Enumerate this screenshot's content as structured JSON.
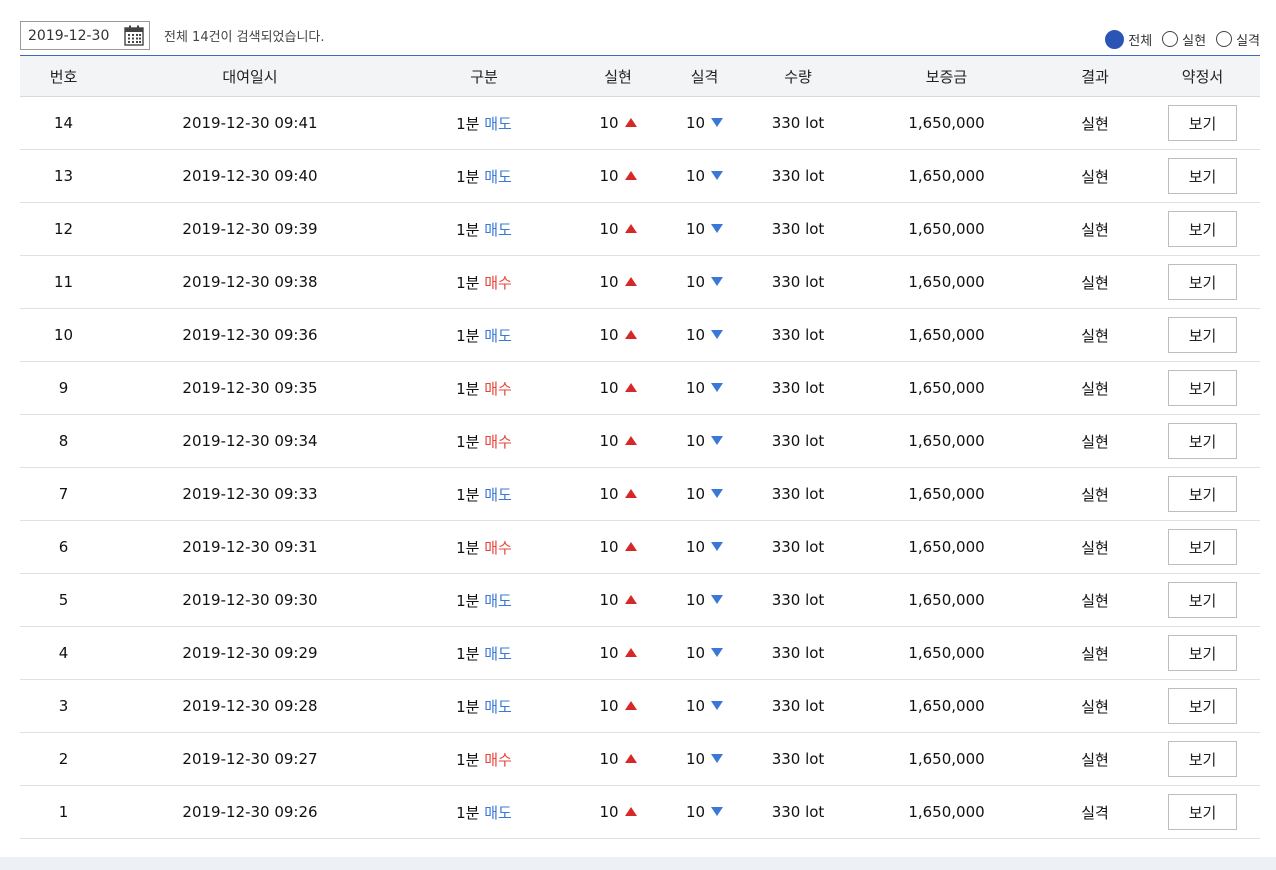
{
  "filter": {
    "date": "2019-12-30",
    "summary": "전체 14건이 검색되었습니다.",
    "radio_options": [
      {
        "label": "전체",
        "checked": true
      },
      {
        "label": "실현",
        "checked": false
      },
      {
        "label": "실격",
        "checked": false
      }
    ]
  },
  "table": {
    "columns": [
      "번호",
      "대여일시",
      "구분",
      "실현",
      "실격",
      "수량",
      "보증금",
      "결과",
      "약정서"
    ],
    "rows": [
      {
        "no": "14",
        "datetime": "2019-12-30 09:41",
        "period": "1분",
        "side": "매도",
        "win": "10",
        "lose": "10",
        "qty": "330 lot",
        "deposit": "1,650,000",
        "result": "실현",
        "action": "보기"
      },
      {
        "no": "13",
        "datetime": "2019-12-30 09:40",
        "period": "1분",
        "side": "매도",
        "win": "10",
        "lose": "10",
        "qty": "330 lot",
        "deposit": "1,650,000",
        "result": "실현",
        "action": "보기"
      },
      {
        "no": "12",
        "datetime": "2019-12-30 09:39",
        "period": "1분",
        "side": "매도",
        "win": "10",
        "lose": "10",
        "qty": "330 lot",
        "deposit": "1,650,000",
        "result": "실현",
        "action": "보기"
      },
      {
        "no": "11",
        "datetime": "2019-12-30 09:38",
        "period": "1분",
        "side": "매수",
        "win": "10",
        "lose": "10",
        "qty": "330 lot",
        "deposit": "1,650,000",
        "result": "실현",
        "action": "보기"
      },
      {
        "no": "10",
        "datetime": "2019-12-30 09:36",
        "period": "1분",
        "side": "매도",
        "win": "10",
        "lose": "10",
        "qty": "330 lot",
        "deposit": "1,650,000",
        "result": "실현",
        "action": "보기"
      },
      {
        "no": "9",
        "datetime": "2019-12-30 09:35",
        "period": "1분",
        "side": "매수",
        "win": "10",
        "lose": "10",
        "qty": "330 lot",
        "deposit": "1,650,000",
        "result": "실현",
        "action": "보기"
      },
      {
        "no": "8",
        "datetime": "2019-12-30 09:34",
        "period": "1분",
        "side": "매수",
        "win": "10",
        "lose": "10",
        "qty": "330 lot",
        "deposit": "1,650,000",
        "result": "실현",
        "action": "보기"
      },
      {
        "no": "7",
        "datetime": "2019-12-30 09:33",
        "period": "1분",
        "side": "매도",
        "win": "10",
        "lose": "10",
        "qty": "330 lot",
        "deposit": "1,650,000",
        "result": "실현",
        "action": "보기"
      },
      {
        "no": "6",
        "datetime": "2019-12-30 09:31",
        "period": "1분",
        "side": "매수",
        "win": "10",
        "lose": "10",
        "qty": "330 lot",
        "deposit": "1,650,000",
        "result": "실현",
        "action": "보기"
      },
      {
        "no": "5",
        "datetime": "2019-12-30 09:30",
        "period": "1분",
        "side": "매도",
        "win": "10",
        "lose": "10",
        "qty": "330 lot",
        "deposit": "1,650,000",
        "result": "실현",
        "action": "보기"
      },
      {
        "no": "4",
        "datetime": "2019-12-30 09:29",
        "period": "1분",
        "side": "매도",
        "win": "10",
        "lose": "10",
        "qty": "330 lot",
        "deposit": "1,650,000",
        "result": "실현",
        "action": "보기"
      },
      {
        "no": "3",
        "datetime": "2019-12-30 09:28",
        "period": "1분",
        "side": "매도",
        "win": "10",
        "lose": "10",
        "qty": "330 lot",
        "deposit": "1,650,000",
        "result": "실현",
        "action": "보기"
      },
      {
        "no": "2",
        "datetime": "2019-12-30 09:27",
        "period": "1분",
        "side": "매수",
        "win": "10",
        "lose": "10",
        "qty": "330 lot",
        "deposit": "1,650,000",
        "result": "실현",
        "action": "보기"
      },
      {
        "no": "1",
        "datetime": "2019-12-30 09:26",
        "period": "1분",
        "side": "매도",
        "win": "10",
        "lose": "10",
        "qty": "330 lot",
        "deposit": "1,650,000",
        "result": "실격",
        "action": "보기"
      }
    ]
  },
  "colors": {
    "accent_blue": "#2a55b5",
    "sell_blue": "#3a78d8",
    "buy_red": "#e8443a",
    "up_red": "#d62828",
    "down_blue": "#3a78d8"
  },
  "icons": {
    "calendar": "calendar-icon",
    "up": "triangle-up-icon",
    "down": "triangle-down-icon"
  }
}
